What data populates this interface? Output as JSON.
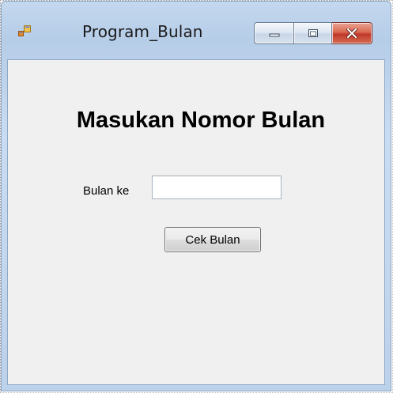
{
  "window": {
    "title": "Program_Bulan",
    "icons": {
      "app": "form-icon",
      "minimize": "minimize-icon",
      "maximize": "maximize-icon",
      "close": "close-icon"
    },
    "colors": {
      "frame": "#bcd1ea",
      "client": "#f0f0f0",
      "close_button": "#c0392b"
    }
  },
  "form": {
    "heading": "Masukan Nomor Bulan",
    "month_label": "Bulan ke",
    "month_input_value": "",
    "check_button_label": "Cek Bulan"
  }
}
